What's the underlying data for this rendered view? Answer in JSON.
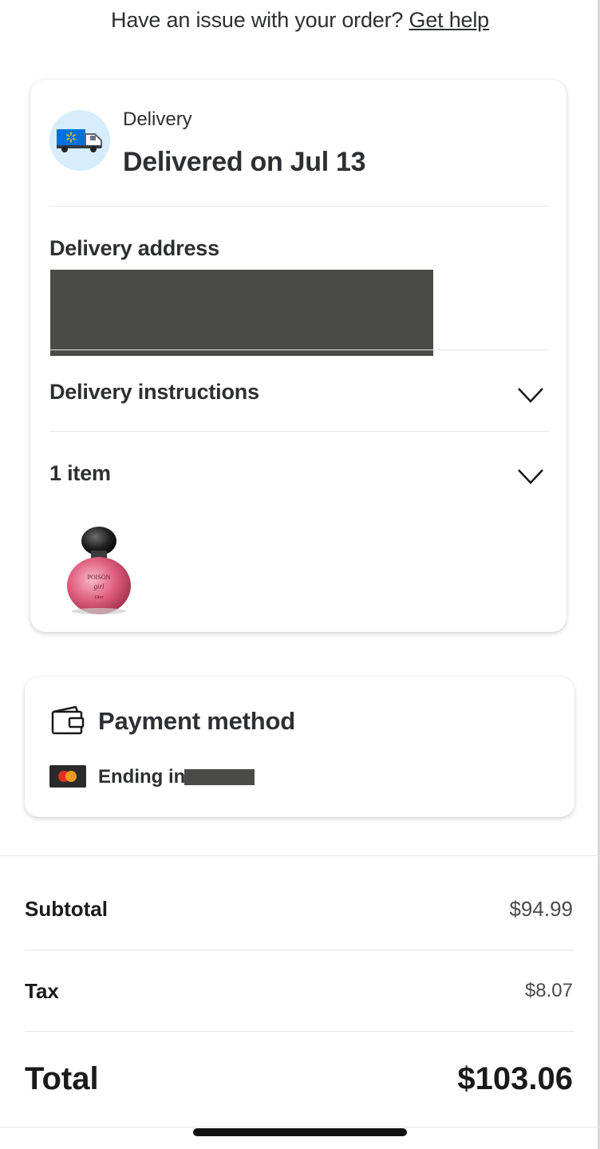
{
  "help": {
    "prompt": "Have an issue with your order?",
    "link": "Get help"
  },
  "delivery": {
    "label": "Delivery",
    "status": "Delivered on Jul 13",
    "icon": "delivery-truck-icon",
    "address_heading": "Delivery address",
    "instructions_heading": "Delivery instructions",
    "items_heading": "1 item",
    "product_image": "perfume-bottle-image"
  },
  "payment": {
    "title": "Payment method",
    "card_label": "Ending in",
    "card_icon": "mastercard-icon"
  },
  "summary": {
    "subtotal_label": "Subtotal",
    "subtotal_value": "$94.99",
    "tax_label": "Tax",
    "tax_value": "$8.07",
    "total_label": "Total",
    "total_value": "$103.06"
  },
  "colors": {
    "text": "#2e2f32",
    "truck_blue": "#0071dc",
    "truck_bg": "#d6eefb",
    "redaction": "#4a4a47"
  }
}
